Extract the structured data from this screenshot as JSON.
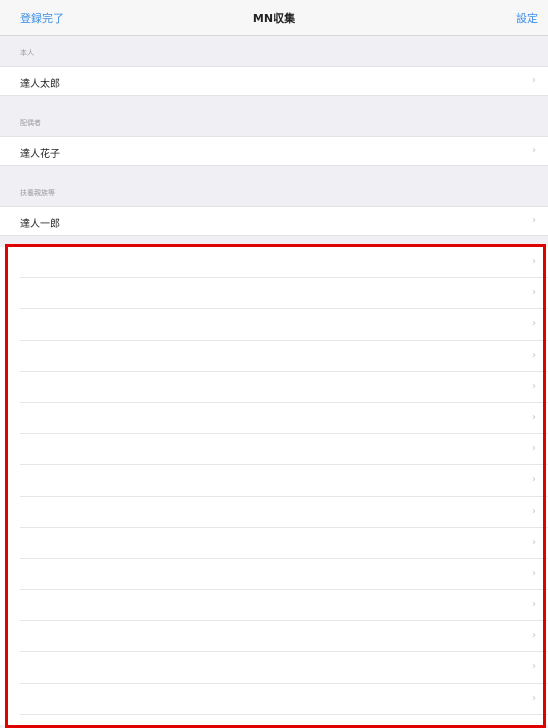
{
  "navbar": {
    "left_label": "登録完了",
    "title": "MN収集",
    "right_label": "設定"
  },
  "sections": [
    {
      "header": "本人",
      "row_label": "達人太郎"
    },
    {
      "header": "配偶者",
      "row_label": "達人花子"
    },
    {
      "header": "扶養親族等",
      "row_label": "達人一郎"
    }
  ],
  "chevron": "›",
  "empty_row_count": 15,
  "highlight_color": "#e00000"
}
